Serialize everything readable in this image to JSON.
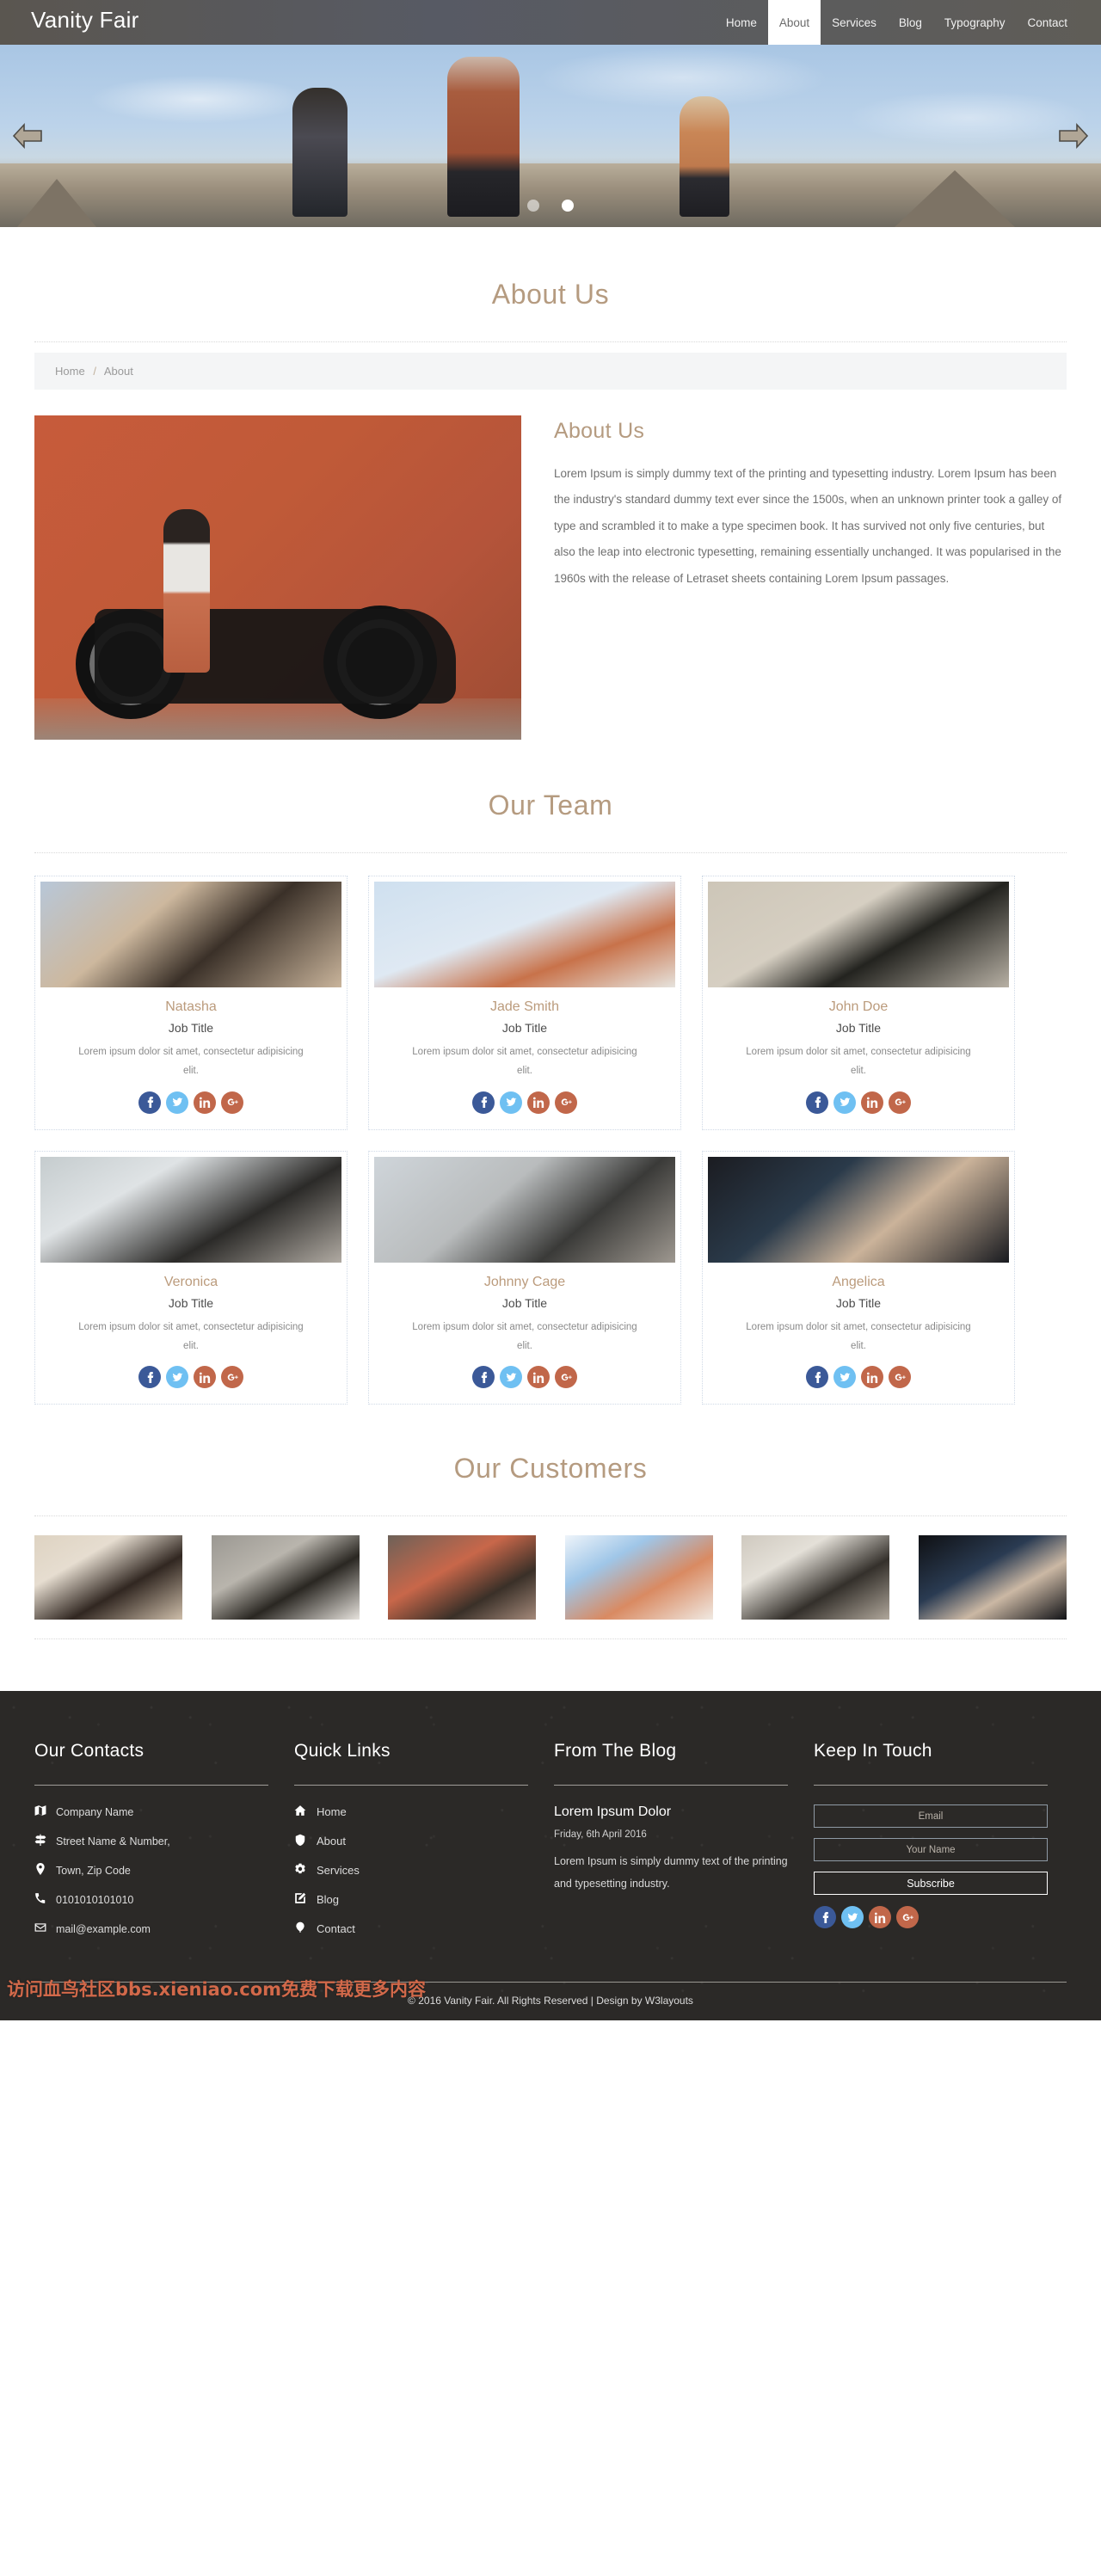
{
  "header": {
    "logo": "Vanity Fair",
    "nav": [
      {
        "label": "Home",
        "active": false
      },
      {
        "label": "About",
        "active": true
      },
      {
        "label": "Services",
        "active": false
      },
      {
        "label": "Blog",
        "active": false
      },
      {
        "label": "Typography",
        "active": false
      },
      {
        "label": "Contact",
        "active": false
      }
    ]
  },
  "hero": {
    "prev_icon": "arrow-left-icon",
    "next_icon": "arrow-right-icon",
    "dots": [
      "inactive",
      "active"
    ]
  },
  "page": {
    "title": "About Us",
    "breadcrumb": {
      "home": "Home",
      "separator": "/",
      "current": "About"
    }
  },
  "about": {
    "heading": "About Us",
    "body": "Lorem Ipsum is simply dummy text of the printing and typesetting industry. Lorem Ipsum has been the industry's standard dummy text ever since the 1500s, when an unknown printer took a galley of type and scrambled it to make a type specimen book. It has survived not only five centuries, but also the leap into electronic typesetting, remaining essentially unchanged. It was popularised in the 1960s with the release of Letraset sheets containing Lorem Ipsum passages.",
    "image_alt": "woman-on-motorcycle-photo"
  },
  "team": {
    "heading": "Our Team",
    "members": [
      {
        "name": "Natasha",
        "job": "Job Title",
        "desc": "Lorem ipsum dolor sit amet, consectetur adipisicing elit."
      },
      {
        "name": "Jade Smith",
        "job": "Job Title",
        "desc": "Lorem ipsum dolor sit amet, consectetur adipisicing elit."
      },
      {
        "name": "John Doe",
        "job": "Job Title",
        "desc": "Lorem ipsum dolor sit amet, consectetur adipisicing elit."
      },
      {
        "name": "Veronica",
        "job": "Job Title",
        "desc": "Lorem ipsum dolor sit amet, consectetur adipisicing elit."
      },
      {
        "name": "Johnny Cage",
        "job": "Job Title",
        "desc": "Lorem ipsum dolor sit amet, consectetur adipisicing elit."
      },
      {
        "name": "Angelica",
        "job": "Job Title",
        "desc": "Lorem ipsum dolor sit amet, consectetur adipisicing elit."
      }
    ],
    "social_labels": [
      "facebook-icon",
      "twitter-icon",
      "linkedin-icon",
      "googleplus-icon"
    ]
  },
  "customers": {
    "heading": "Our Customers",
    "thumbs": [
      "customer-photo-1",
      "customer-photo-2",
      "customer-photo-3",
      "customer-photo-4",
      "customer-photo-5",
      "customer-photo-6"
    ]
  },
  "footer": {
    "contacts": {
      "heading": "Our Contacts",
      "items": [
        {
          "icon": "map-icon",
          "text": "Company Name"
        },
        {
          "icon": "signpost-icon",
          "text": "Street Name & Number,"
        },
        {
          "icon": "marker-icon",
          "text": "Town, Zip Code"
        },
        {
          "icon": "phone-icon",
          "text": "0101010101010"
        },
        {
          "icon": "envelope-icon",
          "text": "mail@example.com"
        }
      ]
    },
    "quick_links": {
      "heading": "Quick Links",
      "items": [
        {
          "icon": "home-icon",
          "label": "Home"
        },
        {
          "icon": "shield-icon",
          "label": "About"
        },
        {
          "icon": "gears-icon",
          "label": "Services"
        },
        {
          "icon": "pencil-icon",
          "label": "Blog"
        },
        {
          "icon": "balloon-icon",
          "label": "Contact"
        }
      ]
    },
    "blog": {
      "heading": "From The Blog",
      "post_title": "Lorem Ipsum Dolor",
      "post_date": "Friday, 6th April 2016",
      "post_body": "Lorem Ipsum is simply dummy text of the printing and typesetting industry."
    },
    "keep_in_touch": {
      "heading": "Keep In Touch",
      "email_placeholder": "Email",
      "email_value": "",
      "name_placeholder": "Your Name",
      "name_value": "",
      "subscribe_label": "Subscribe",
      "social_labels": [
        "facebook-icon",
        "twitter-icon",
        "linkedin-icon",
        "googleplus-icon"
      ]
    },
    "copyright": "© 2016 Vanity Fair. All Rights Reserved | Design by W3layouts",
    "watermark": "访问血鸟社区bbs.xieniao.com免费下载更多内容"
  },
  "colors": {
    "accent": "#b59b80",
    "facebook": "#3b5998",
    "twitter": "#6fc0f2",
    "linkedin": "#c1674a",
    "googleplus": "#c1674a",
    "footer_bg": "#2b2927",
    "header_bg": "#5a5650",
    "watermark": "#d2694a"
  }
}
